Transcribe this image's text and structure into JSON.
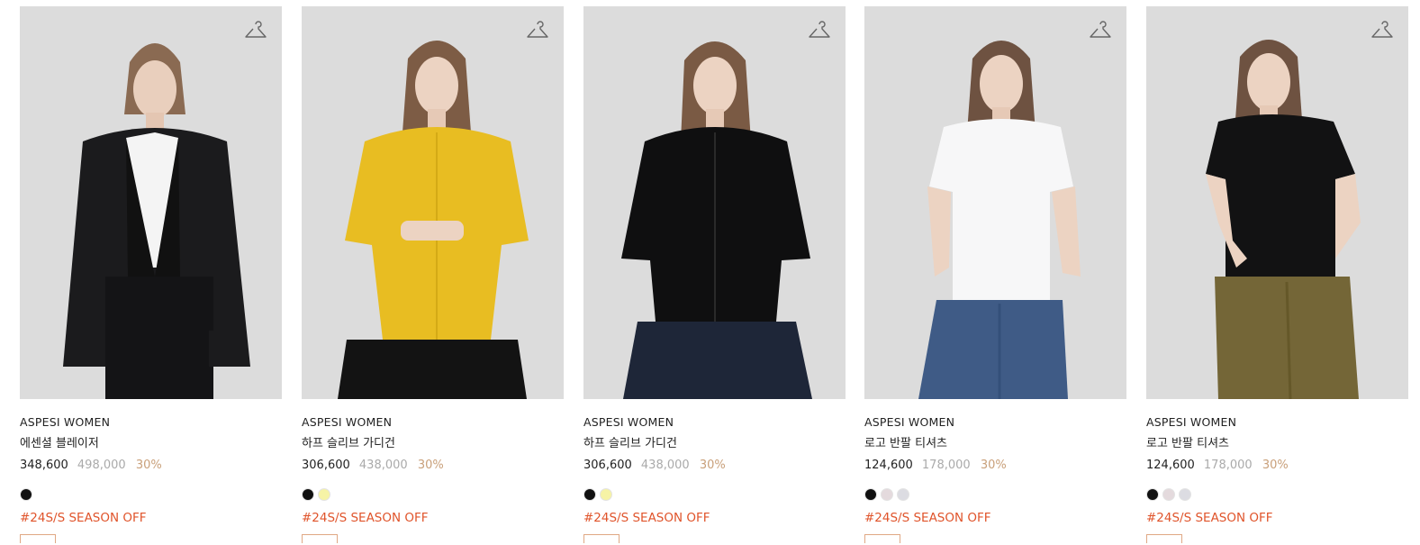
{
  "colors": {
    "accent_tag": "#e0542b",
    "discount": "#c9a07a",
    "photo_bg": "#dadada"
  },
  "products": [
    {
      "brand": "ASPESI WOMEN",
      "name": "에센셜 블레이저",
      "price": "348,600",
      "original_price": "498,000",
      "discount": "30%",
      "swatches": [
        "#111111"
      ],
      "tag": "#24S/S SEASON OFF",
      "wishlist_icon": "hanger-icon"
    },
    {
      "brand": "ASPESI WOMEN",
      "name": "하프 슬리브 가디건",
      "price": "306,600",
      "original_price": "438,000",
      "discount": "30%",
      "swatches": [
        "#111111",
        "#f6f3a6"
      ],
      "tag": "#24S/S SEASON OFF",
      "wishlist_icon": "hanger-icon"
    },
    {
      "brand": "ASPESI WOMEN",
      "name": "하프 슬리브 가디건",
      "price": "306,600",
      "original_price": "438,000",
      "discount": "30%",
      "swatches": [
        "#111111",
        "#f6f3a6"
      ],
      "tag": "#24S/S SEASON OFF",
      "wishlist_icon": "hanger-icon"
    },
    {
      "brand": "ASPESI WOMEN",
      "name": "로고 반팔 티셔츠",
      "price": "124,600",
      "original_price": "178,000",
      "discount": "30%",
      "swatches": [
        "#111111",
        "#e4dadd",
        "#dcdce2"
      ],
      "tag": "#24S/S SEASON OFF",
      "wishlist_icon": "hanger-icon"
    },
    {
      "brand": "ASPESI WOMEN",
      "name": "로고 반팔 티셔츠",
      "price": "124,600",
      "original_price": "178,000",
      "discount": "30%",
      "swatches": [
        "#111111",
        "#e4dadd",
        "#dcdce2"
      ],
      "tag": "#24S/S SEASON OFF",
      "wishlist_icon": "hanger-icon"
    }
  ]
}
